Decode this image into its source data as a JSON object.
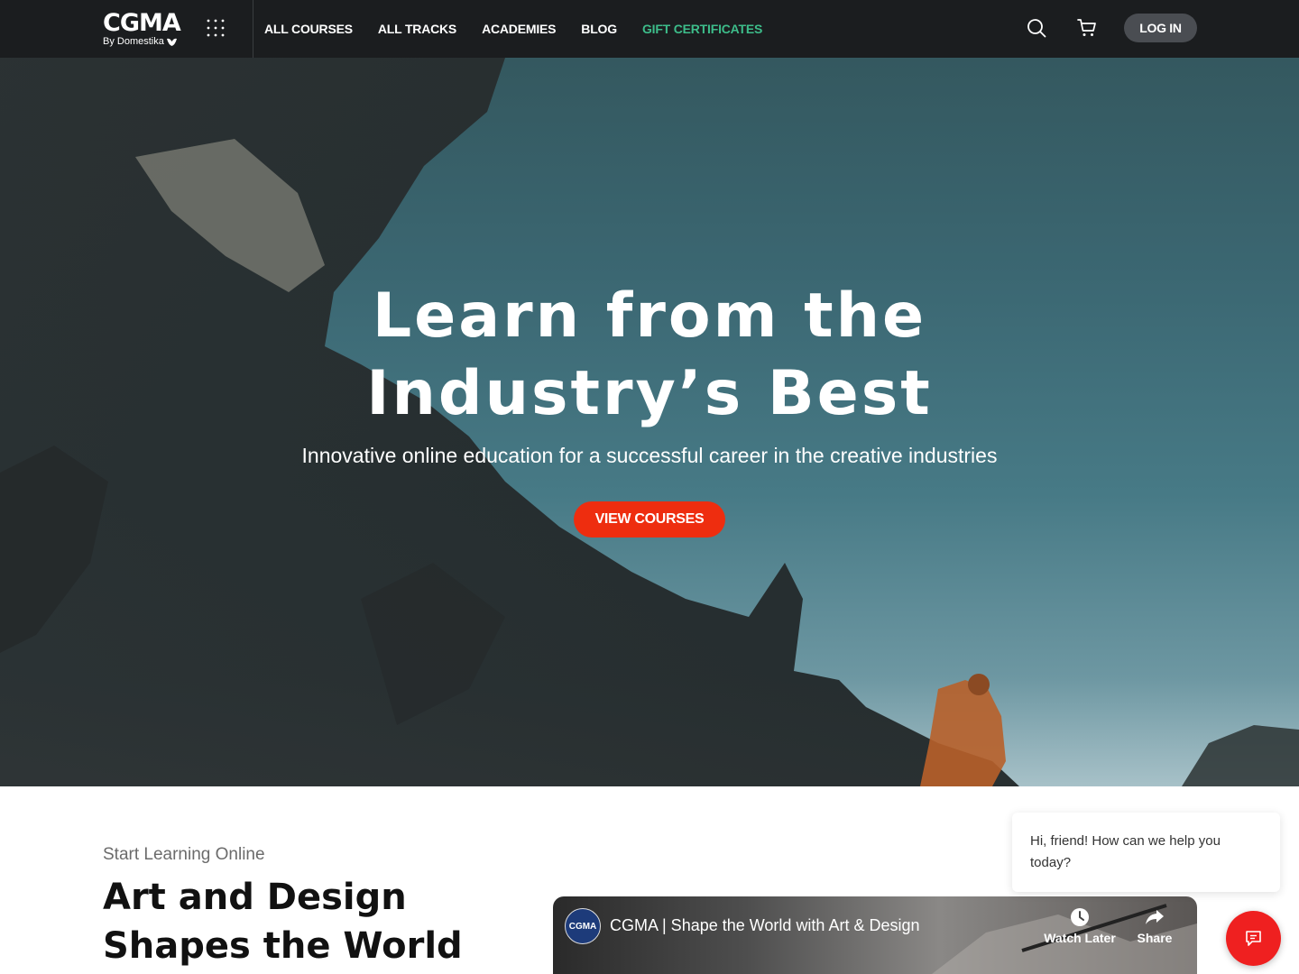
{
  "brand": {
    "logo_text": "CGMA",
    "logo_sub": "By Domestika"
  },
  "nav": {
    "items": [
      {
        "label": "ALL COURSES"
      },
      {
        "label": "ALL TRACKS"
      },
      {
        "label": "ACADEMIES"
      },
      {
        "label": "BLOG"
      },
      {
        "label": "GIFT CERTIFICATES"
      }
    ],
    "login_label": "LOG IN",
    "icons": [
      "apps-grid-icon",
      "search-icon",
      "cart-icon"
    ]
  },
  "hero": {
    "title_line1": "Learn from the",
    "title_line2": "Industry’s Best",
    "subtitle": "Innovative online education for a successful career in the creative industries",
    "cta_label": "VIEW COURSES"
  },
  "section": {
    "eyebrow": "Start Learning Online",
    "title": "Art and Design Shapes the World"
  },
  "video": {
    "channel_badge": "CGMA",
    "title": "CGMA | Shape the World with Art & Design",
    "watch_later_label": "Watch Later",
    "share_label": "Share"
  },
  "chat": {
    "greeting": "Hi, friend! How can we help you today?"
  },
  "colors": {
    "nav_bg": "#1b1d1f",
    "gift_accent": "#3dbd8a",
    "cta": "#ee2d0f",
    "chat_launcher": "#ef2020"
  }
}
